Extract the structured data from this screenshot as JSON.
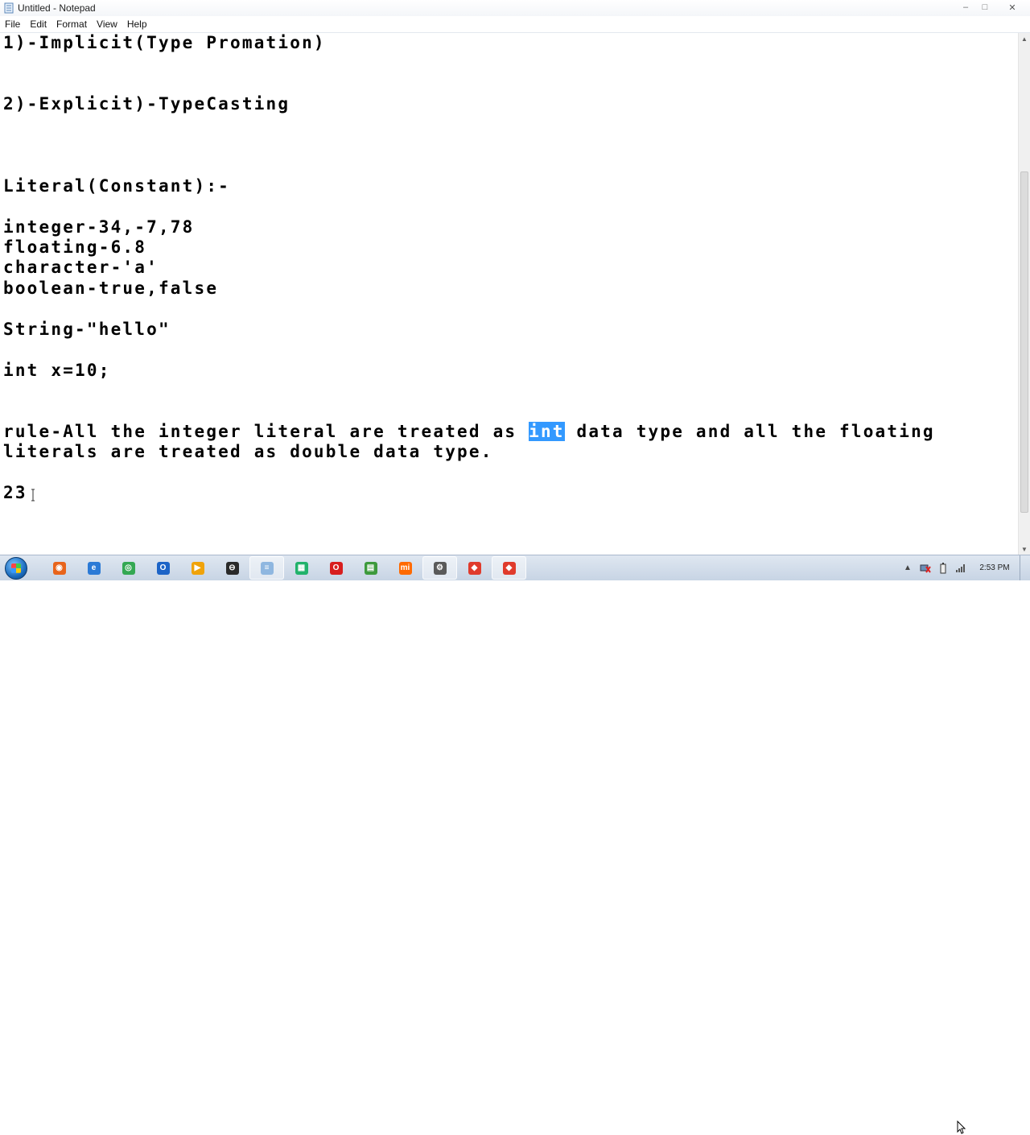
{
  "window": {
    "title": "Untitled - Notepad",
    "controls": {
      "minimize": "–",
      "maximize": "□",
      "close": "✕"
    }
  },
  "menu": [
    "File",
    "Edit",
    "Format",
    "View",
    "Help"
  ],
  "editor": {
    "lines_before_selection": "1)-Implicit(Type Promation)\n\n\n2)-Explicit)-TypeCasting\n\n\n\nLiteral(Constant):-\n\ninteger-34,-7,78\nfloating-6.8\ncharacter-'a'\nboolean-true,false\n\nString-\"hello\"\n\nint x=10;\n\n\nrule-All the integer literal are treated as ",
    "selected_text": "int",
    "lines_after_selection": " data type and all the floating\nliterals are treated as double data type.\n\n23"
  },
  "taskbar": {
    "apps": [
      {
        "name": "firefox",
        "color": "#e8641b",
        "glyph": "◉"
      },
      {
        "name": "internet-explorer",
        "color": "#2b7ad6",
        "glyph": "e"
      },
      {
        "name": "chrome",
        "color": "#34a853",
        "glyph": "◎"
      },
      {
        "name": "outlook",
        "color": "#1d64c7",
        "glyph": "O"
      },
      {
        "name": "media-player",
        "color": "#f0a30a",
        "glyph": "▶"
      },
      {
        "name": "globe",
        "color": "#2a2a2a",
        "glyph": "⊖"
      },
      {
        "name": "notepad",
        "color": "#8fb7e0",
        "glyph": "≡"
      },
      {
        "name": "calculator",
        "color": "#21b26b",
        "glyph": "▦"
      },
      {
        "name": "opera",
        "color": "#d81e1e",
        "glyph": "O"
      },
      {
        "name": "app-green",
        "color": "#3d9a3d",
        "glyph": "▤"
      },
      {
        "name": "mi-app",
        "color": "#ff6a00",
        "glyph": "mi"
      },
      {
        "name": "settings-app",
        "color": "#5a5a5a",
        "glyph": "⚙"
      },
      {
        "name": "recorder",
        "color": "#e03b2c",
        "glyph": "◆"
      },
      {
        "name": "recorder-2",
        "color": "#e03b2c",
        "glyph": "◆"
      }
    ],
    "clock": "2:53 PM"
  }
}
